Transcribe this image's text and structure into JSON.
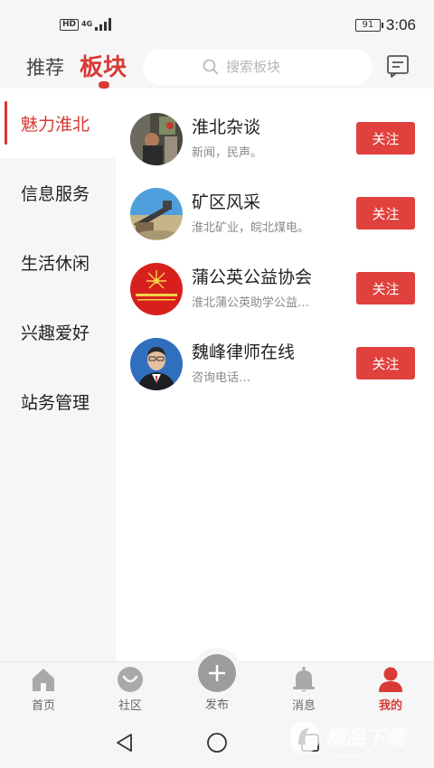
{
  "status_bar": {
    "network_badge": "HD",
    "network_type": "4G",
    "battery": "91",
    "time": "3:06"
  },
  "header": {
    "tab_recommend": "推荐",
    "tab_board": "板块",
    "search_placeholder": "搜索板块"
  },
  "sidebar": {
    "items": [
      {
        "label": "魅力淮北",
        "active": true
      },
      {
        "label": "信息服务",
        "active": false
      },
      {
        "label": "生活休闲",
        "active": false
      },
      {
        "label": "兴趣爱好",
        "active": false
      },
      {
        "label": "站务管理",
        "active": false
      }
    ]
  },
  "boards": [
    {
      "name": "淮北杂谈",
      "desc": "新闻，民声。",
      "follow": "关注"
    },
    {
      "name": "矿区风采",
      "desc": "淮北矿业，皖北煤电。",
      "follow": "关注"
    },
    {
      "name": "蒲公英公益协会",
      "desc": "淮北蒲公英助学公益…",
      "follow": "关注"
    },
    {
      "name": "魏峰律师在线",
      "desc": "咨询电话…",
      "follow": "关注"
    }
  ],
  "bottom_nav": {
    "home": "首页",
    "community": "社区",
    "publish": "发布",
    "messages": "消息",
    "mine": "我的"
  },
  "watermark": {
    "text": "精品下载",
    "url": "www.jpxz.com"
  },
  "colors": {
    "accent": "#d93a36",
    "follow_button": "#e0413d",
    "background": "#f6f6f6"
  }
}
